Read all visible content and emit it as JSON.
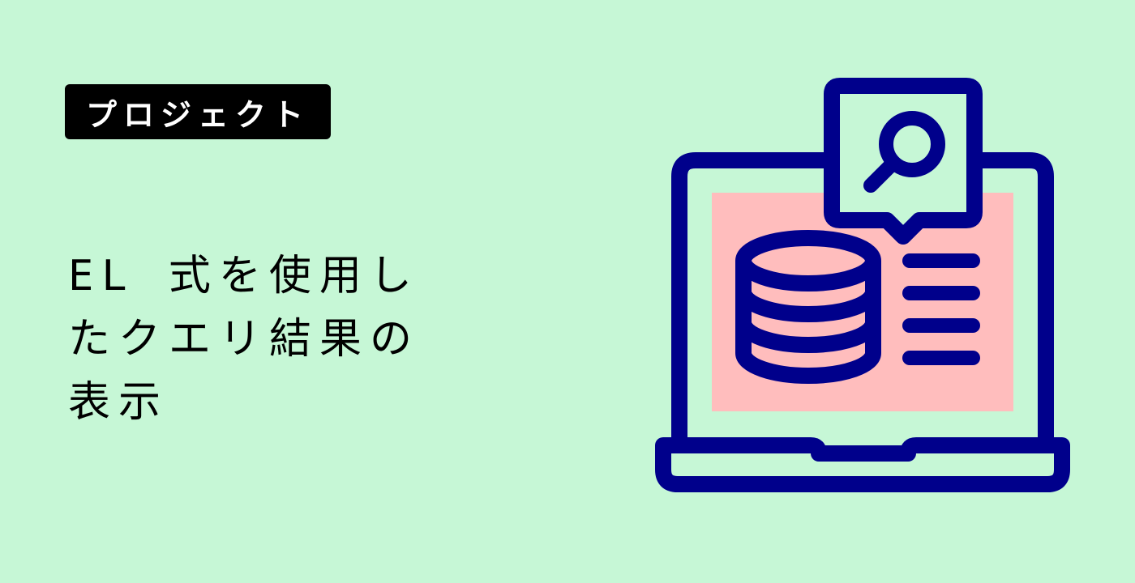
{
  "badge": {
    "label": "プロジェクト"
  },
  "title": {
    "lines": [
      "EL 式を使用し",
      "たクエリ結果の",
      "表示"
    ]
  },
  "colors": {
    "background": "#c6f7d6",
    "badge_background": "#000000",
    "badge_text": "#ffffff",
    "illustration_outline": "#00008b",
    "screen_fill": "#ffbdbd"
  },
  "illustration": {
    "icons": [
      "laptop-icon",
      "database-icon",
      "search-icon",
      "list-lines-icon"
    ]
  }
}
